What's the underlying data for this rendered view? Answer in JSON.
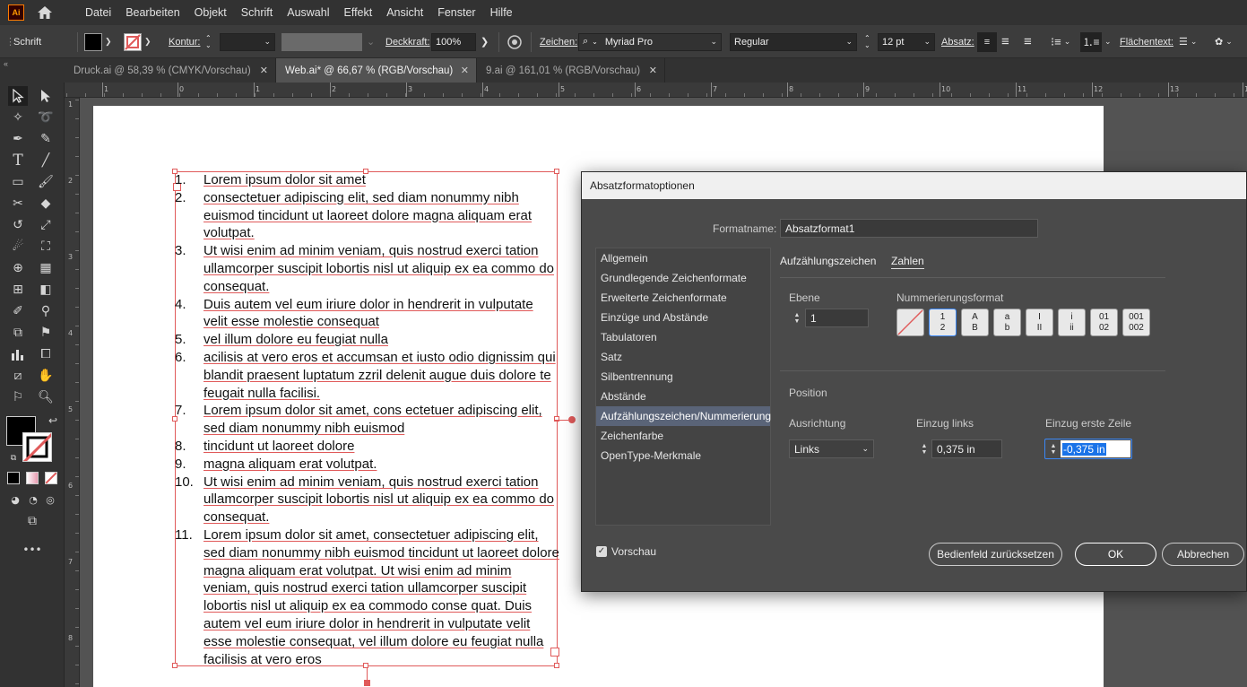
{
  "app": {
    "logo": "Ai"
  },
  "menu": [
    "Datei",
    "Bearbeiten",
    "Objekt",
    "Schrift",
    "Auswahl",
    "Effekt",
    "Ansicht",
    "Fenster",
    "Hilfe"
  ],
  "control": {
    "mode_label": "Schrift",
    "stroke_label": "Kontur:",
    "opacity_label": "Deckkraft:",
    "opacity_value": "100%",
    "char_label": "Zeichen:",
    "font_family": "Myriad Pro",
    "font_style": "Regular",
    "font_size": "12 pt",
    "paragraph_label": "Absatz:",
    "fill_text_label": "Flächentext:"
  },
  "tabs": [
    {
      "label": "Druck.ai @ 58,39 % (CMYK/Vorschau)",
      "active": false
    },
    {
      "label": "Web.ai* @ 66,67 % (RGB/Vorschau)",
      "active": true
    },
    {
      "label": "9.ai @ 161,01 % (RGB/Vorschau)",
      "active": false
    }
  ],
  "rulers": {
    "top": [
      "1",
      "0",
      "1",
      "2",
      "3",
      "4",
      "5",
      "6",
      "7",
      "8",
      "9",
      "10",
      "11",
      "12",
      "13",
      "14"
    ],
    "left": [
      "1",
      "2",
      "3",
      "4",
      "5",
      "6",
      "7",
      "8"
    ]
  },
  "list_items": [
    {
      "num": "1.",
      "text": "Lorem ipsum dolor sit amet"
    },
    {
      "num": "2.",
      "text": "consectetuer adipiscing elit, sed diam nonummy nibh euismod tincidunt ut laoreet dolore magna aliquam erat volutpat."
    },
    {
      "num": "3.",
      "text": "Ut wisi enim ad minim veniam, quis nostrud exerci tation ullamcorper suscipit lobortis nisl ut aliquip ex ea commo do consequat."
    },
    {
      "num": "4.",
      "text": "Duis autem vel eum iriure dolor in hendrerit in vulputate velit esse molestie consequat"
    },
    {
      "num": "5.",
      "text": "vel illum dolore eu feugiat nulla"
    },
    {
      "num": "6.",
      "text": "acilisis at vero eros et accumsan et iusto odio dignissim qui blandit praesent luptatum zzril delenit augue duis dolore te feugait nulla facilisi."
    },
    {
      "num": "7.",
      "text": "Lorem ipsum dolor sit amet, cons ectetuer adipiscing elit, sed diam nonummy nibh euismod"
    },
    {
      "num": "8.",
      "text": "tincidunt ut laoreet dolore"
    },
    {
      "num": "9.",
      "text": "magna aliquam erat volutpat."
    },
    {
      "num": "10.",
      "text": "Ut wisi enim ad minim veniam, quis nostrud exerci tation ullamcorper suscipit lobortis nisl ut aliquip ex ea commo do consequat."
    },
    {
      "num": "11.",
      "text": "Lorem ipsum dolor sit amet, consectetuer adipiscing elit, sed diam nonummy nibh euismod tincidunt ut laoreet dolore magna aliquam erat volutpat. Ut wisi enim ad minim veniam, quis nostrud exerci tation ullamcorper suscipit lobortis nisl ut aliquip ex ea commodo conse quat. Duis autem vel eum iriure dolor in hendrerit in vulputate velit esse molestie consequat, vel illum dolore eu feugiat nulla facilisis at vero eros"
    }
  ],
  "dialog": {
    "title": "Absatzformatoptionen",
    "format_name_label": "Formatname:",
    "format_name_value": "Absatzformat1",
    "categories": [
      "Allgemein",
      "Grundlegende Zeichenformate",
      "Erweiterte Zeichenformate",
      "Einzüge und Abstände",
      "Tabulatoren",
      "Satz",
      "Silbentrennung",
      "Abstände",
      "Aufzählungszeichen/Nummerierung",
      "Zeichenfarbe",
      "OpenType-Merkmale"
    ],
    "selected_category": "Aufzählungszeichen/Nummerierung",
    "subtabs": [
      "Aufzählungszeichen",
      "Zahlen"
    ],
    "active_subtab": "Zahlen",
    "level_label": "Ebene",
    "level_value": "1",
    "numbering_label": "Nummerierungsformat",
    "numbering_formats": [
      {
        "top": "1",
        "bottom": "2"
      },
      {
        "top": "A",
        "bottom": "B"
      },
      {
        "top": "a",
        "bottom": "b"
      },
      {
        "top": "I",
        "bottom": "II"
      },
      {
        "top": "i",
        "bottom": "ii"
      },
      {
        "top": "01",
        "bottom": "02"
      },
      {
        "top": "001",
        "bottom": "002"
      }
    ],
    "position_label": "Position",
    "alignment_label": "Ausrichtung",
    "alignment_value": "Links",
    "indent_left_label": "Einzug links",
    "indent_left_value": "0,375 in",
    "first_line_label": "Einzug erste Zeile",
    "first_line_value": "-0,375 in",
    "preview_label": "Vorschau",
    "preview_checked": true,
    "reset_button": "Bedienfeld zurücksetzen",
    "ok_button": "OK",
    "cancel_button": "Abbrechen"
  },
  "colors": {
    "accent_red": "#e05a5a",
    "selection_blue": "#1a73e8"
  }
}
